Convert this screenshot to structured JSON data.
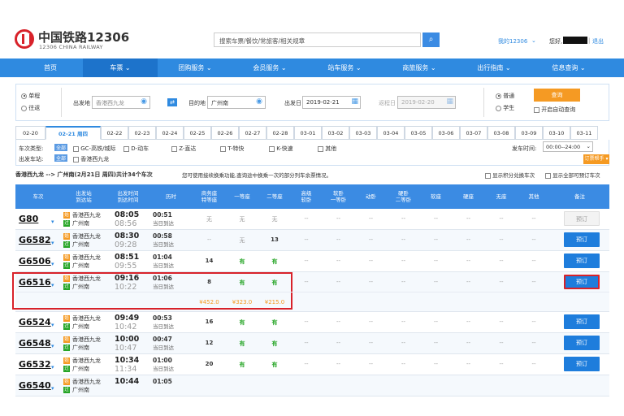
{
  "header": {
    "logo_cn": "中国铁路12306",
    "logo_en": "12306 CHINA RAILWAY",
    "search_placeholder": "搜索车票/餐饮/常旅客/相关规章",
    "my_account": "我的12306",
    "greeting": "您好,",
    "logout": "退出"
  },
  "nav": [
    "首页",
    "车票",
    "团购服务",
    "会员服务",
    "站车服务",
    "商旅服务",
    "出行指南",
    "信息查询"
  ],
  "query": {
    "trip_single": "单程",
    "trip_round": "往返",
    "from_label": "出发地",
    "from_value": "香港西九龙",
    "to_label": "目的地",
    "to_value": "广州南",
    "date_label": "出发日",
    "date_value": "2019-02-21",
    "return_label": "返程日",
    "return_value": "2019-02-20",
    "type_normal": "普通",
    "type_student": "学生",
    "search_button": "查询",
    "auto_query": "开启自动查询"
  },
  "dates": [
    "02-20",
    "02-21 周四",
    "02-22",
    "02-23",
    "02-24",
    "02-25",
    "02-26",
    "02-27",
    "02-28",
    "03-01",
    "03-02",
    "03-03",
    "03-04",
    "03-05",
    "03-06",
    "03-07",
    "03-08",
    "03-09",
    "03-10",
    "03-11"
  ],
  "filter": {
    "type_label": "车次类型:",
    "all": "全部",
    "types": [
      "GC-高铁/城际",
      "D-动车",
      "Z-直达",
      "T-特快",
      "K-快速",
      "其他"
    ],
    "station_label": "出发车站:",
    "station": "香港西九龙",
    "time_label": "发车时间:",
    "time_value": "00:00--24:00"
  },
  "summary": {
    "route": "香港西九龙 --> 广州南(2月21日 周四)共计34个车次",
    "notice": "您可使用接续换乘功能,查询途中换乘一次的部分列车余票情况。",
    "show_points": "显示积分兑换车次",
    "show_all": "显示全部可预订车次",
    "helper": "订票帮手"
  },
  "columns": [
    "车次",
    "出发站\n到达站",
    "出发时间\n到达时间",
    "历时",
    "商务座\n特等座",
    "一等座",
    "二等座",
    "高级\n软卧",
    "软卧\n一等卧",
    "动卧",
    "硬卧\n二等卧",
    "软座",
    "硬座",
    "无座",
    "其他",
    "备注"
  ],
  "trains": [
    {
      "no": "G80",
      "from": "香港西九龙",
      "to": "广州南",
      "dep": "08:05",
      "arr": "08:56",
      "dur": "00:51",
      "arrday": "当日到达",
      "biz": "无",
      "first": "无",
      "second": "无",
      "book": "预订",
      "enabled": false
    },
    {
      "no": "G6582",
      "from": "香港西九龙",
      "to": "广州南",
      "dep": "08:30",
      "arr": "09:28",
      "dur": "00:58",
      "arrday": "当日到达",
      "biz": "--",
      "first": "无",
      "second": "13",
      "book": "预订",
      "enabled": true
    },
    {
      "no": "G6506",
      "from": "香港西九龙",
      "to": "广州南",
      "dep": "08:51",
      "arr": "09:55",
      "dur": "01:04",
      "arrday": "当日到达",
      "biz": "14",
      "first": "有",
      "second": "有",
      "book": "预订",
      "enabled": true
    },
    {
      "no": "G6516",
      "from": "香港西九龙",
      "to": "广州南",
      "dep": "09:16",
      "arr": "10:22",
      "dur": "01:06",
      "arrday": "当日到达",
      "biz": "8",
      "first": "有",
      "second": "有",
      "book": "预订",
      "enabled": true
    },
    {
      "no": "G6524",
      "from": "香港西九龙",
      "to": "广州南",
      "dep": "09:49",
      "arr": "10:42",
      "dur": "00:53",
      "arrday": "当日到达",
      "biz": "16",
      "first": "有",
      "second": "有",
      "book": "预订",
      "enabled": true
    },
    {
      "no": "G6548",
      "from": "香港西九龙",
      "to": "广州南",
      "dep": "10:00",
      "arr": "10:47",
      "dur": "00:47",
      "arrday": "当日到达",
      "biz": "12",
      "first": "有",
      "second": "有",
      "book": "预订",
      "enabled": true
    },
    {
      "no": "G6532",
      "from": "香港西九龙",
      "to": "广州南",
      "dep": "10:34",
      "arr": "11:34",
      "dur": "01:00",
      "arrday": "当日到达",
      "biz": "20",
      "first": "有",
      "second": "有",
      "book": "预订",
      "enabled": true
    },
    {
      "no": "G6540",
      "from": "香港西九龙",
      "to": "广州南",
      "dep": "10:44",
      "arr": "",
      "dur": "01:05",
      "arrday": "",
      "biz": "",
      "first": "",
      "second": "",
      "book": "",
      "enabled": true
    }
  ],
  "prices": {
    "biz": "¥452.0",
    "first": "¥323.0",
    "second": "¥215.0"
  },
  "colors": {
    "nav": "#2f8ae0",
    "accent": "#f59a23",
    "highlight": "#d8222a"
  }
}
